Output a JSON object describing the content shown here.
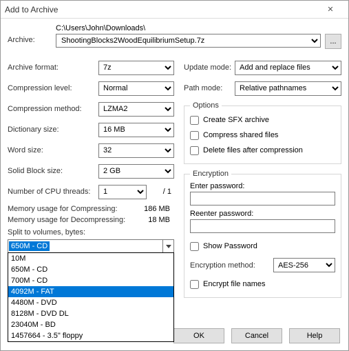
{
  "title": "Add to Archive",
  "archive": {
    "label": "Archive:",
    "dir": "C:\\Users\\John\\Downloads\\",
    "file": "ShootingBlocks2WoodEquilibriumSetup.7z",
    "browse": "..."
  },
  "left": {
    "format_lbl": "Archive format:",
    "format_val": "7z",
    "level_lbl": "Compression level:",
    "level_val": "Normal",
    "method_lbl": "Compression method:",
    "method_val": "LZMA2",
    "dict_lbl": "Dictionary size:",
    "dict_val": "16 MB",
    "word_lbl": "Word size:",
    "word_val": "32",
    "block_lbl": "Solid Block size:",
    "block_val": "2 GB",
    "threads_lbl": "Number of CPU threads:",
    "threads_val": "1",
    "threads_max": "/ 1",
    "mem_comp_lbl": "Memory usage for Compressing:",
    "mem_comp_val": "186 MB",
    "mem_decomp_lbl": "Memory usage for Decompressing:",
    "mem_decomp_val": "18 MB",
    "split_lbl": "Split to volumes, bytes:",
    "split_selected": "650M - CD",
    "split_options": [
      "10M",
      "650M - CD",
      "700M - CD",
      "4092M - FAT",
      "4480M - DVD",
      "8128M - DVD DL",
      "23040M - BD",
      "1457664 - 3.5\" floppy"
    ]
  },
  "right": {
    "update_lbl": "Update mode:",
    "update_val": "Add and replace files",
    "path_lbl": "Path mode:",
    "path_val": "Relative pathnames",
    "options_legend": "Options",
    "sfx_lbl": "Create SFX archive",
    "shared_lbl": "Compress shared files",
    "delete_lbl": "Delete files after compression",
    "enc_legend": "Encryption",
    "enter_pw_lbl": "Enter password:",
    "reenter_pw_lbl": "Reenter password:",
    "show_pw_lbl": "Show Password",
    "enc_method_lbl": "Encryption method:",
    "enc_method_val": "AES-256",
    "enc_names_lbl": "Encrypt file names"
  },
  "buttons": {
    "ok": "OK",
    "cancel": "Cancel",
    "help": "Help"
  }
}
